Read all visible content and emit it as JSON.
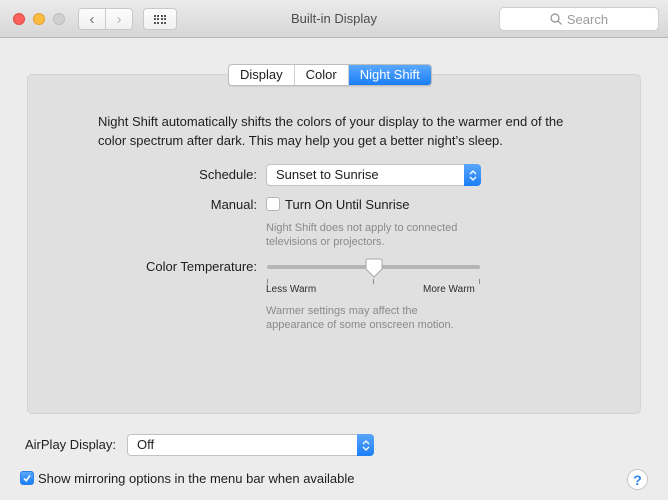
{
  "window": {
    "title": "Built-in Display",
    "search_placeholder": "Search",
    "nav_back": "‹",
    "nav_forward": "›"
  },
  "tabs": [
    {
      "label": "Display",
      "active": false
    },
    {
      "label": "Color",
      "active": false
    },
    {
      "label": "Night Shift",
      "active": true
    }
  ],
  "night_shift": {
    "description_line1": "Night Shift automatically shifts the colors of your display to the warmer end of the",
    "description_line2": "color spectrum after dark. This may help you get a better night’s sleep.",
    "schedule_label": "Schedule:",
    "schedule_value": "Sunset to Sunrise",
    "manual_label": "Manual:",
    "manual_checkbox_label": "Turn On Until Sunrise",
    "manual_checked": false,
    "manual_hint_line1": "Night Shift does not apply to connected",
    "manual_hint_line2": "televisions or projectors.",
    "temperature_label": "Color Temperature:",
    "temperature_value_fraction": 0.5,
    "temperature_min_label": "Less Warm",
    "temperature_max_label": "More Warm",
    "temperature_hint_line1": "Warmer settings may affect the",
    "temperature_hint_line2": "appearance of some onscreen motion."
  },
  "airplay": {
    "label": "AirPlay Display:",
    "value": "Off",
    "mirroring_label": "Show mirroring options in the menu bar when available",
    "mirroring_checked": true
  },
  "help_label": "?",
  "colors": {
    "accent": "#1a7ef6",
    "close": "#fc605c",
    "minimize": "#fdbc40"
  }
}
